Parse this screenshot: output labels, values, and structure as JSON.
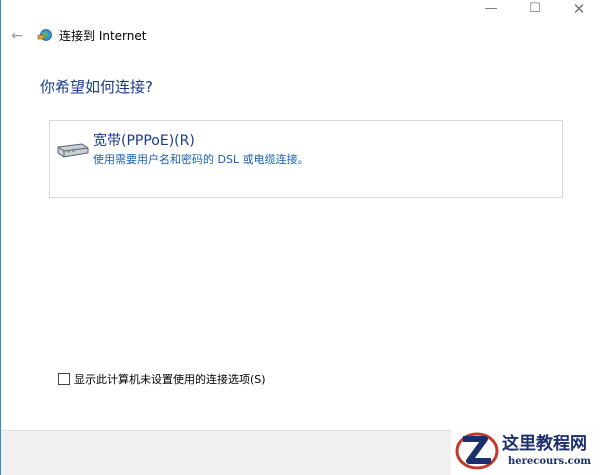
{
  "window": {
    "title": "连接到 Internet",
    "back_icon": "back-arrow-icon",
    "app_icon": "network-globe-icon",
    "controls": {
      "minimize": "—",
      "maximize": "☐",
      "close": "✕"
    }
  },
  "main": {
    "question": "你希望如何连接?",
    "options": [
      {
        "icon": "broadband-modem-icon",
        "title": "宽带(PPPoE)(R)",
        "description": "使用需要用户名和密码的 DSL 或电缆连接。"
      }
    ],
    "show_unconfigured_checkbox": {
      "label": "显示此计算机未设置使用的连接选项(S)",
      "checked": false
    }
  },
  "watermark": {
    "text": "这里教程网",
    "url": "herecours.com"
  },
  "colors": {
    "heading_blue": "#1a3b8c",
    "link_blue": "#1a5fb4",
    "footer_bg": "#f0f0f0"
  }
}
